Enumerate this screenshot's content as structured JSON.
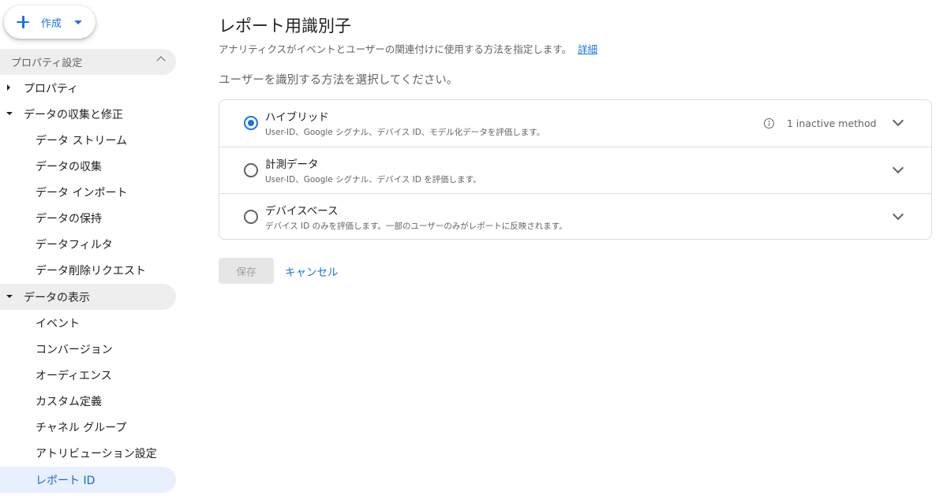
{
  "create_button": {
    "label": "作成"
  },
  "sidebar": {
    "section": "プロパティ設定",
    "items": [
      {
        "label": "プロパティ"
      },
      {
        "label": "データの収集と修正"
      },
      {
        "label": "データ ストリーム"
      },
      {
        "label": "データの収集"
      },
      {
        "label": "データ インポート"
      },
      {
        "label": "データの保持"
      },
      {
        "label": "データフィルタ"
      },
      {
        "label": "データ削除リクエスト"
      },
      {
        "label": "データの表示"
      },
      {
        "label": "イベント"
      },
      {
        "label": "コンバージョン"
      },
      {
        "label": "オーディエンス"
      },
      {
        "label": "カスタム定義"
      },
      {
        "label": "チャネル グループ"
      },
      {
        "label": "アトリビューション設定"
      },
      {
        "label": "レポート ID"
      }
    ]
  },
  "main": {
    "title": "レポート用識別子",
    "description": "アナリティクスがイベントとユーザーの関連付けに使用する方法を指定します。",
    "learn_more": "詳細",
    "prompt": "ユーザーを識別する方法を選択してください。",
    "options": [
      {
        "title": "ハイブリッド",
        "subtitle": "User-ID、Google シグナル、デバイス ID、モデル化データを評価します。",
        "note": "1 inactive method",
        "selected": true
      },
      {
        "title": "計測データ",
        "subtitle": "User-ID、Google シグナル、デバイス ID を評価します。",
        "selected": false
      },
      {
        "title": "デバイスベース",
        "subtitle": "デバイス ID のみを評価します。一部のユーザーのみがレポートに反映されます。",
        "selected": false
      }
    ],
    "save_label": "保存",
    "cancel_label": "キャンセル"
  },
  "colors": {
    "accent": "#1a73e8",
    "active_nav_bg": "#e8f0fe",
    "section_bg": "#eeeeee"
  }
}
